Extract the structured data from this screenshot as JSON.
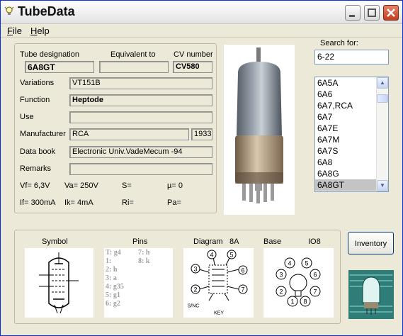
{
  "window": {
    "title": "TubeData",
    "menu": [
      {
        "label": "File",
        "underline": "F",
        "rest": "ile"
      },
      {
        "label": "Help",
        "underline": "H",
        "rest": "elp"
      }
    ]
  },
  "details": {
    "tube_designation_label": "Tube designation",
    "tube_designation": "6A8GT",
    "equivalent_to_label": "Equivalent to",
    "equivalent_to": "",
    "cv_number_label": "CV number",
    "cv_number": "CV580",
    "variations_label": "Variations",
    "variations": "VT151B",
    "function_label": "Function",
    "function": "Heptode",
    "use_label": "Use",
    "use": "",
    "manufacturer_label": "Manufacturer",
    "manufacturer": "RCA",
    "year": "1933",
    "data_book_label": "Data book",
    "data_book": "Electronic Univ.VadeMecum -94",
    "remarks_label": "Remarks",
    "remarks": "",
    "vf": "Vf= 6,3V",
    "va": "Va= 250V",
    "s": "S=",
    "mu": "µ=    0",
    "if": "If= 300mA",
    "ik": "Ik=  4mA",
    "ri": "Ri=",
    "pa": "Pa="
  },
  "search": {
    "label": "Search for:",
    "value": "6-22",
    "list": [
      "6A5A",
      "6A6",
      "6A7,RCA",
      "6A7",
      "6A7E",
      "6A7M",
      "6A7S",
      "6A8",
      "6A8G",
      "6A8GT"
    ],
    "selected": "6A8GT"
  },
  "diagrams": {
    "symbol_label": "Symbol",
    "pins_label": "Pins",
    "diagram_label": "Diagram",
    "diagram_code": "8A",
    "base_label": "Base",
    "base_code": "IO8",
    "pins_col1": [
      "T: g4",
      "1:",
      "2: h",
      "3: a",
      "4: g35",
      "5: g1",
      "6: g2"
    ],
    "pins_col2": [
      "7: h",
      "8: k"
    ],
    "diagram_pin_labels": [
      "4",
      "5",
      "3",
      "6",
      "2",
      "7",
      "S/NC",
      "KEY"
    ],
    "base_pin_labels": [
      "4",
      "5",
      "3",
      "6",
      "2",
      "7",
      "1",
      "8"
    ]
  },
  "inventory_button": "Inventory",
  "colors": {
    "titlebar_close": "#c33b1b",
    "list_selection": "#c4c4c4",
    "window_bg": "#ece9d8"
  }
}
